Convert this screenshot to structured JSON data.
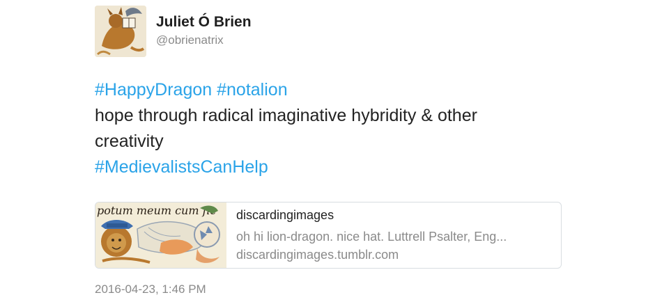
{
  "author": {
    "display_name": "Juliet Ó Brien",
    "handle": "@obrienatrix",
    "avatar_icon": "medieval-creature-reading-avatar"
  },
  "tweet": {
    "lines": [
      {
        "parts": [
          {
            "text": "#HappyDragon",
            "type": "hashtag"
          },
          {
            "text": " ",
            "type": "text"
          },
          {
            "text": "#notalion",
            "type": "hashtag"
          }
        ]
      },
      {
        "parts": [
          {
            "text": "hope through radical imaginative hybridity & other",
            "type": "text"
          }
        ]
      },
      {
        "parts": [
          {
            "text": "creativity",
            "type": "text"
          }
        ]
      },
      {
        "parts": [
          {
            "text": "#MedievalistsCanHelp",
            "type": "hashtag"
          }
        ]
      }
    ]
  },
  "link_card": {
    "thumb_caption": "potum meum cum fle",
    "thumb_icon": "lion-dragon-manuscript-thumbnail",
    "title": "discardingimages",
    "description": "oh hi lion-dragon. nice hat. Luttrell Psalter, Eng...",
    "domain": "discardingimages.tumblr.com"
  },
  "timestamp": "2016-04-23, 1:46 PM",
  "colors": {
    "hashtag": "#2aa3e8",
    "text": "#222222",
    "secondary": "#8a8a8a",
    "card_border": "#d8dde1"
  }
}
